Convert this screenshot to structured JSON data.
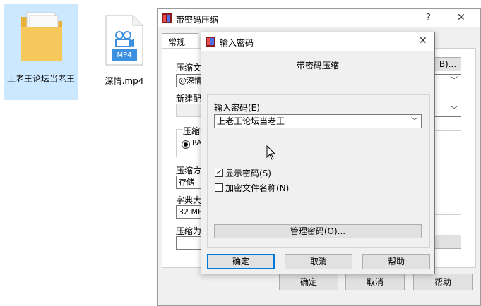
{
  "desktop": {
    "folder_label": "上老王论坛当老王",
    "mp4_badge": "MP4",
    "mp4_label": "深情.mp4"
  },
  "main_dialog": {
    "title": "带密码压缩",
    "help_glyph": "?",
    "close_glyph": "✕",
    "tab_general": "常规",
    "label_compress_file": "压缩文",
    "field_filename": "@深情.",
    "browse_suffix": "B)...",
    "label_new_config": "新建配",
    "label_format": "压缩",
    "radio_rar": "RA",
    "label_method": "压缩方",
    "method_value": "存储",
    "label_dict": "字典大",
    "dict_value": "32 MB",
    "label_split": "压缩为",
    "ok": "确定",
    "cancel": "取消",
    "help": "帮助"
  },
  "password_dialog": {
    "title": "输入密码",
    "close_glyph": "✕",
    "heading": "带密码压缩",
    "password_label": "输入密码(E)",
    "password_value": "上老王论坛当老王",
    "show_password": "显示密码(S)",
    "show_password_checked": true,
    "encrypt_names": "加密文件名称(N)",
    "encrypt_names_checked": false,
    "manage_button": "管理密码(O)...",
    "ok": "确定",
    "cancel": "取消",
    "help": "帮助"
  },
  "colors": {
    "accent": "#0078d7",
    "folder": "#f6c75b",
    "mp4_badge": "#3d8fe0"
  }
}
